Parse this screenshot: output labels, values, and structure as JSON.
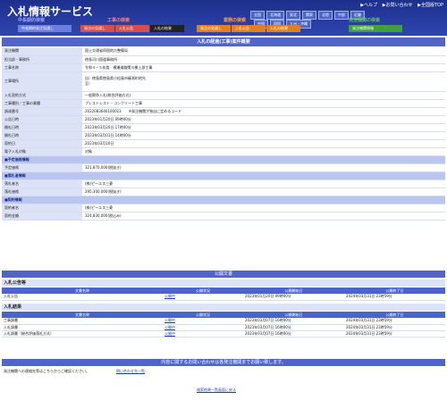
{
  "header": {
    "logo": "入札情報サービス",
    "links": [
      "▶ヘルプ",
      "▶お問い合わせ",
      "▶全国版TOP"
    ],
    "regions_row1": [
      "全国",
      "北海道",
      "東北",
      "関東",
      "北陸",
      "中部",
      "近畿"
    ],
    "regions_row2": [
      "中国",
      "四国",
      "九州・沖縄"
    ],
    "categories": [
      {
        "label": "中長期的検索",
        "color": "#a0a0ff"
      },
      {
        "label": "工事の検索",
        "color": "#ff8080"
      },
      {
        "label": "業務の検索",
        "color": "#ffa040"
      },
      {
        "label": "発注機関の検索",
        "color": "#60c060"
      }
    ],
    "tabs": [
      {
        "label": "中長期的発注見通し",
        "color": "#6d7ee0"
      },
      {
        "label": "発注の見通し",
        "color": "#d45050"
      },
      {
        "label": "入札公告",
        "color": "#d45050"
      },
      {
        "label": "入札の結果",
        "color": "#222"
      },
      {
        "label": "発注の見通し",
        "color": "#e08020"
      },
      {
        "label": "入札公告",
        "color": "#e08020"
      },
      {
        "label": "入札の結果",
        "color": "#e08020"
      },
      {
        "label": "発注機関情報",
        "color": "#40a040"
      }
    ]
  },
  "page_title": "入札の経過(工事)案件概要",
  "rows": [
    {
      "label": "発注機関",
      "value": "国土交通省四国地方整備局"
    },
    {
      "label": "担当部・事務所",
      "value": "徳島河川国道事務所"
    },
    {
      "label": "工事名称",
      "value": "令和４−５年度　横瀬道路関川橋上部工事"
    },
    {
      "label": "工事場所",
      "value": "自）徳島県徳島県小松島市櫛渕町地先\n至）"
    },
    {
      "label": "入札契約方式",
      "value": "一般競争入札(総合評価方式)"
    },
    {
      "label": "工事種別／工事の業種",
      "value": "プレストレスト・コンクリート工事"
    },
    {
      "label": "調達番号",
      "value": "2022083640100023　　※発注機関が独自に定めるコード"
    },
    {
      "label": "公告日時",
      "value": "2023年01月20日 09時00分"
    },
    {
      "label": "開札日時",
      "value": "2023年03月20日 17時00分"
    },
    {
      "label": "開札日時",
      "value": "2023年03月01日 14時00分"
    },
    {
      "label": "契約日",
      "value": "2023年03月16日"
    },
    {
      "label": "電子入札対象",
      "value": "対象"
    }
  ],
  "sections": [
    {
      "title": "■予定価格情報",
      "rows": [
        {
          "label": "予定価格",
          "value": "321,870,000(税抜き)"
        }
      ]
    },
    {
      "title": "■落札者情報",
      "rows": [
        {
          "label": "落札者名",
          "value": "(株)ピーエス三菱"
        },
        {
          "label": "落札価格",
          "value": "295,300,000(税抜き)"
        }
      ]
    },
    {
      "title": "■契約情報",
      "rows": [
        {
          "label": "契約者名",
          "value": "(株)ピーエス三菱"
        },
        {
          "label": "契約金額",
          "value": "324,830,000(税込み)"
        }
      ]
    }
  ],
  "public_docs": {
    "title": "公開文書",
    "headers": [
      "文書名称",
      "公開状況",
      "公開開始日",
      "公開終了日"
    ],
    "announce_title": "入札公告等",
    "announce_rows": [
      {
        "name": "入札公告",
        "status": "公開中",
        "start": "2023年01月20日 09時00分",
        "end": "2024年03月31日 23時59分"
      }
    ],
    "result_title": "入札結果",
    "result_rows": [
      {
        "name": "工事調書",
        "status": "公開中",
        "start": "2023年03月07日 16時00分",
        "end": "2024年03月31日 23時59分"
      },
      {
        "name": "入札調書",
        "status": "公開中",
        "start": "2023年03月07日 16時00分",
        "end": "2024年03月31日 23時59分"
      },
      {
        "name": "入札調書（総合評価落札方式）",
        "status": "公開中",
        "start": "2023年03月07日 16時00分",
        "end": "2024年03月31日 23時59分"
      }
    ]
  },
  "contact": {
    "title": "内容に関するお問い合わせは各発注機関までお願い致します。",
    "text": "発注機関への連絡先等はこちらからご確認ください。",
    "link": "問い合わせ先一覧"
  },
  "back_link": "検索結果一覧画面に戻る"
}
